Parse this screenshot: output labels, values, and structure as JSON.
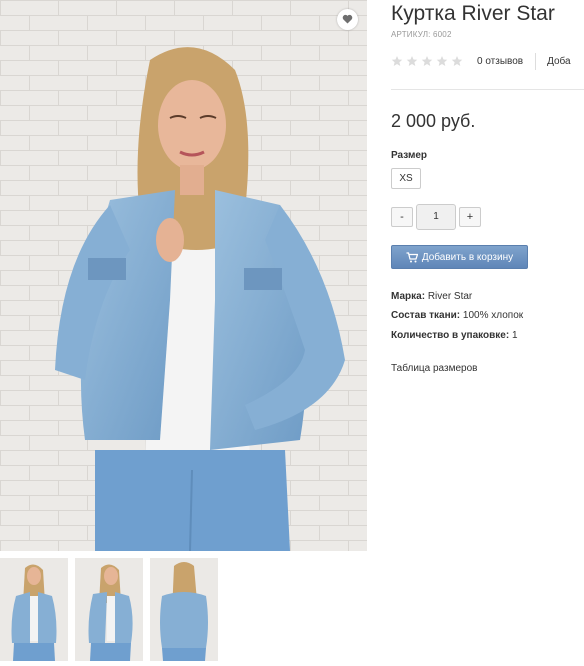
{
  "product": {
    "title": "Куртка River Star",
    "sku": "АРТИКУЛ: 6002",
    "price": "2 000 руб.",
    "image_alt": "Джинсовая куртка River Star",
    "rating_stars": 0,
    "rating_max": 5
  },
  "reviews": {
    "count_label": "0 отзывов",
    "add_label": "Доба"
  },
  "options": {
    "size_label": "Размер",
    "sizes": [
      "XS"
    ]
  },
  "quantity": {
    "minus": "-",
    "value": "1",
    "plus": "+"
  },
  "cart": {
    "button_label": "Добавить в корзину",
    "icon": "cart-icon"
  },
  "specs": [
    {
      "label": "Марка:",
      "value": "River Star"
    },
    {
      "label": "Состав ткани:",
      "value": "100% хлопок"
    },
    {
      "label": "Количество в упаковке:",
      "value": "1"
    }
  ],
  "links": {
    "size_table": "Таблица размеров"
  },
  "icons": {
    "wishlist": "heart-icon",
    "rating": "star-icon"
  },
  "colors": {
    "accent": "#6b8fbf",
    "star_empty": "#dcdcdc",
    "denim": "#7ea9cf"
  }
}
